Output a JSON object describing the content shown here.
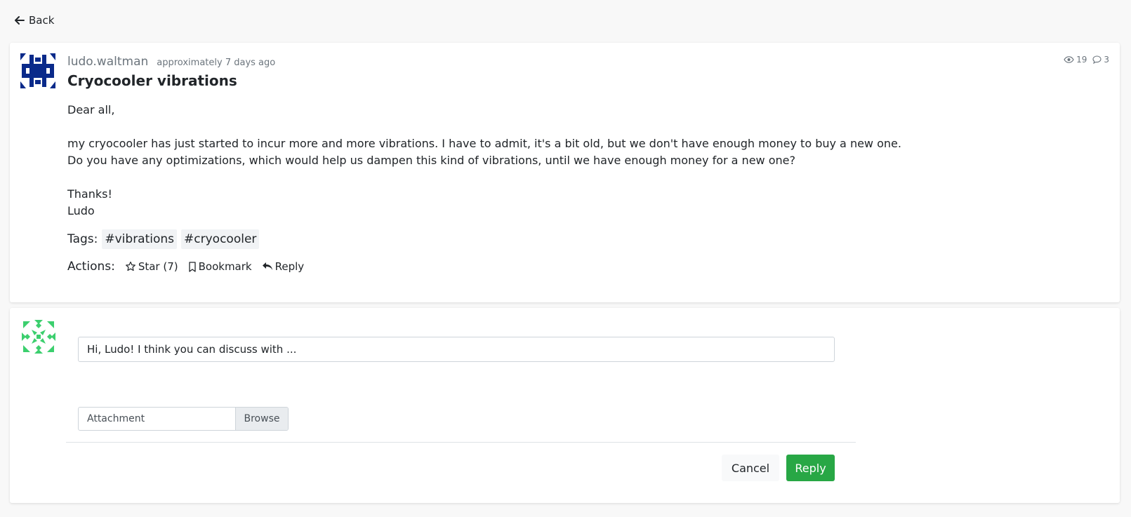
{
  "nav": {
    "back_label": "Back"
  },
  "post": {
    "author": "ludo.waltman",
    "time": "approximately 7 days ago",
    "views": "19",
    "comments": "3",
    "title": "Cryocooler vibrations",
    "body": "Dear all,\n\nmy cryocooler has just started to incur more and more vibrations. I have to admit, it's a bit old, but we don't have enough money to buy a new one.\nDo you have any optimizations, which would help us dampen this kind of vibrations, until we have enough money for a new one?\n\nThanks!\nLudo",
    "tags_label": "Tags:",
    "tags": [
      "#vibrations",
      "#cryocooler"
    ],
    "actions_label": "Actions:",
    "actions": {
      "star": "Star (7)",
      "bookmark": "Bookmark",
      "reply": "Reply"
    }
  },
  "reply_form": {
    "input_value": "Hi, Ludo! I think you can discuss with ...",
    "attachment_placeholder": "Attachment",
    "browse_label": "Browse",
    "cancel_label": "Cancel",
    "submit_label": "Reply"
  },
  "colors": {
    "accent_green": "#28a745",
    "author_avatar": "#0a2a8a",
    "reply_avatar": "#3ccf6e"
  }
}
